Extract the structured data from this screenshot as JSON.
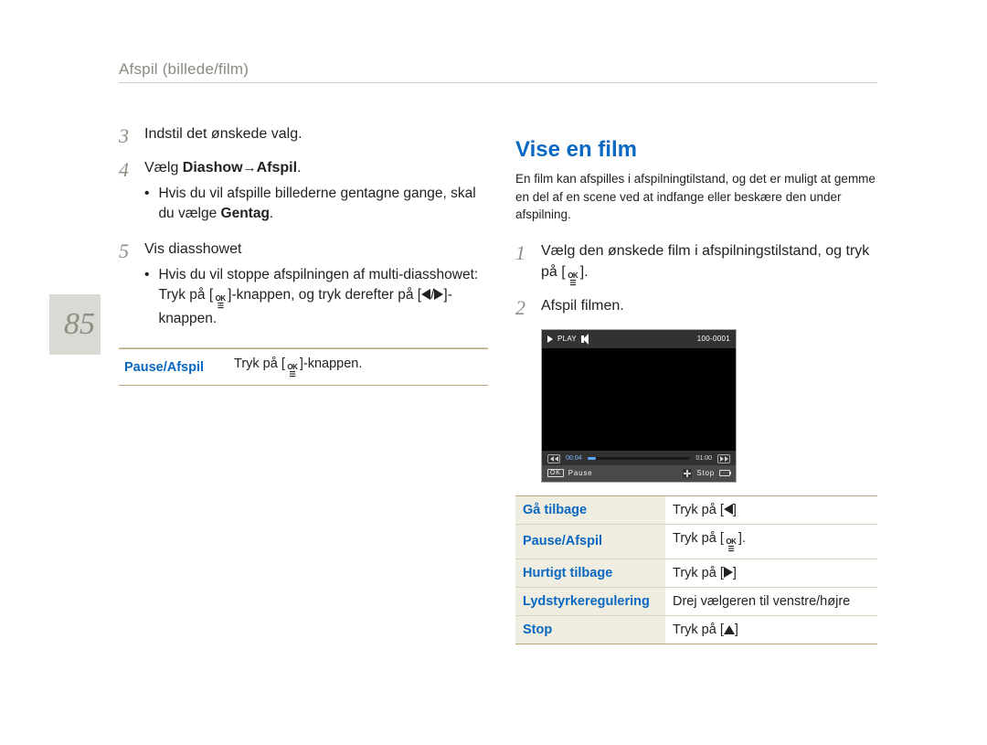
{
  "page_number": "85",
  "header": "Afspil (billede/film)",
  "left": {
    "step3": {
      "num": "3",
      "text": "Indstil det ønskede valg."
    },
    "step4": {
      "num": "4",
      "prefix": "Vælg ",
      "bold1": "Diashow",
      "arrow": " → ",
      "bold2": "Afspil",
      "suffix": ".",
      "bullet": {
        "pre": "Hvis du vil afspille billederne gentagne gange, skal du vælge ",
        "bold": "Gentag",
        "post": "."
      }
    },
    "step5": {
      "num": "5",
      "text": "Vis diasshowet",
      "bullet": {
        "pre": "Hvis du vil stoppe afspilningen af multi-diasshowet: Tryk på [",
        "mid": "]-knappen, og tryk derefter på [",
        "post": "]-knappen."
      }
    },
    "table": {
      "label": "Pause/Afspil",
      "value_pre": "Tryk på [",
      "value_post": "]-knappen."
    }
  },
  "right": {
    "title": "Vise en film",
    "intro": "En film kan afspilles i afspilningtilstand, og det er muligt at gemme en del af en scene ved at indfange eller beskære den under afspilning.",
    "step1": {
      "num": "1",
      "pre": "Vælg den ønskede film i afspilningstilstand, og tryk på [",
      "post": "]."
    },
    "step2": {
      "num": "2",
      "text": "Afspil filmen."
    },
    "film": {
      "play": "PLAY",
      "fileno": "100-0001",
      "time_cur": "00:04",
      "time_tot": "01:00",
      "pause": "Pause",
      "stop": "Stop",
      "ok": "OK"
    },
    "table": {
      "rows": [
        {
          "label": "Gå tilbage",
          "value": "Tryk på [",
          "icon": "left",
          "post": "]"
        },
        {
          "label": "Pause/Afspil",
          "value": "Tryk på [",
          "icon": "ok",
          "post": "]."
        },
        {
          "label": "Hurtigt tilbage",
          "value": "Tryk på [",
          "icon": "right",
          "post": "]"
        },
        {
          "label": "Lydstyrkeregulering",
          "value": "Drej vælgeren til venstre/højre",
          "icon": "none",
          "post": ""
        },
        {
          "label": "Stop",
          "value": "Tryk på [",
          "icon": "up",
          "post": "]"
        }
      ]
    }
  }
}
